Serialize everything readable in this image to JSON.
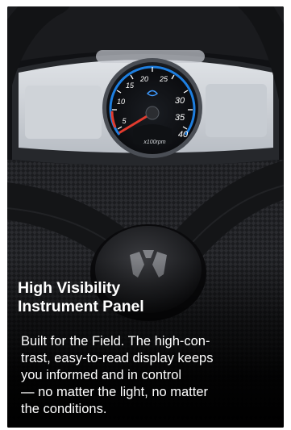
{
  "feature": {
    "title_line1": "High Visibility",
    "title_line2": "Instrument Panel",
    "body": " Built for the Field. The high-con-\ntrast, easy-to-read display keeps\nyou informed and in control\n— no matter the light, no matter\nthe conditions."
  },
  "gauge": {
    "tick_labels": [
      "5",
      "10",
      "15",
      "20",
      "25",
      "30",
      "35",
      "40"
    ],
    "unit": "x100rpm",
    "needle_value": 3
  },
  "colors": {
    "accent_blue": "#1e7fe0",
    "needle_red": "#e23b2e",
    "text": "#ffffff"
  },
  "icons": {
    "logo": "brand-shield-emblem"
  }
}
